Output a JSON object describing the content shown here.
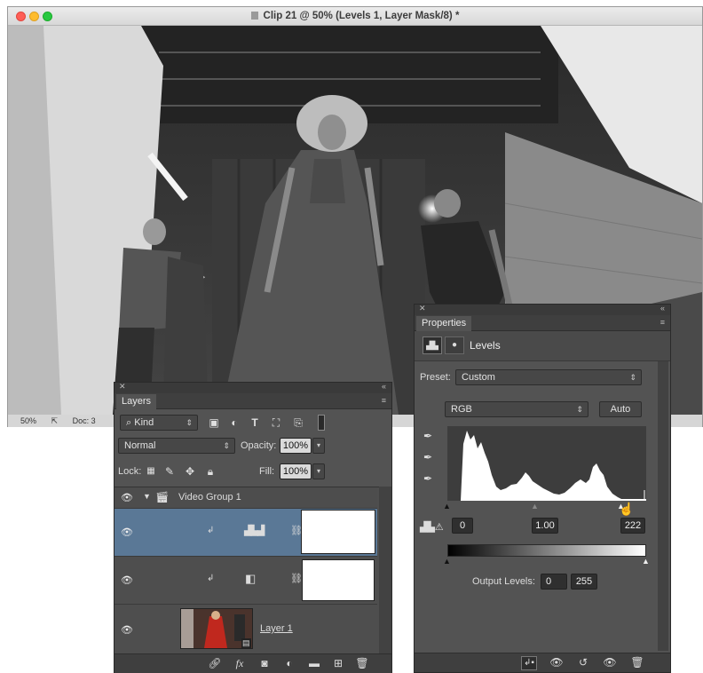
{
  "window": {
    "title": "Clip 21 @ 50% (Levels 1, Layer Mask/8) *",
    "status_zoom": "50%",
    "status_doc": "Doc: 3"
  },
  "layers_panel": {
    "tab": "Layers",
    "filter_kind": "Kind",
    "blend_mode": "Normal",
    "opacity_label": "Opacity:",
    "opacity_value": "100%",
    "lock_label": "Lock:",
    "fill_label": "Fill:",
    "fill_value": "100%",
    "layers": [
      {
        "name": "Video Group 1",
        "type": "group"
      },
      {
        "name": "",
        "type": "levels-adjustment",
        "selected": true
      },
      {
        "name": "",
        "type": "brightness-contrast-adjustment"
      },
      {
        "name": "Layer 1",
        "type": "video-layer"
      }
    ]
  },
  "properties_panel": {
    "tab": "Properties",
    "adjustment": "Levels",
    "preset_label": "Preset:",
    "preset_value": "Custom",
    "channel": "RGB",
    "auto_label": "Auto",
    "input_black": "0",
    "input_gamma": "1.00",
    "input_white": "222",
    "output_label": "Output Levels:",
    "output_black": "0",
    "output_white": "255"
  },
  "colors": {
    "panel_bg": "#535353",
    "selected_row": "#5a7896",
    "titlebar": "#e3e3e3"
  }
}
